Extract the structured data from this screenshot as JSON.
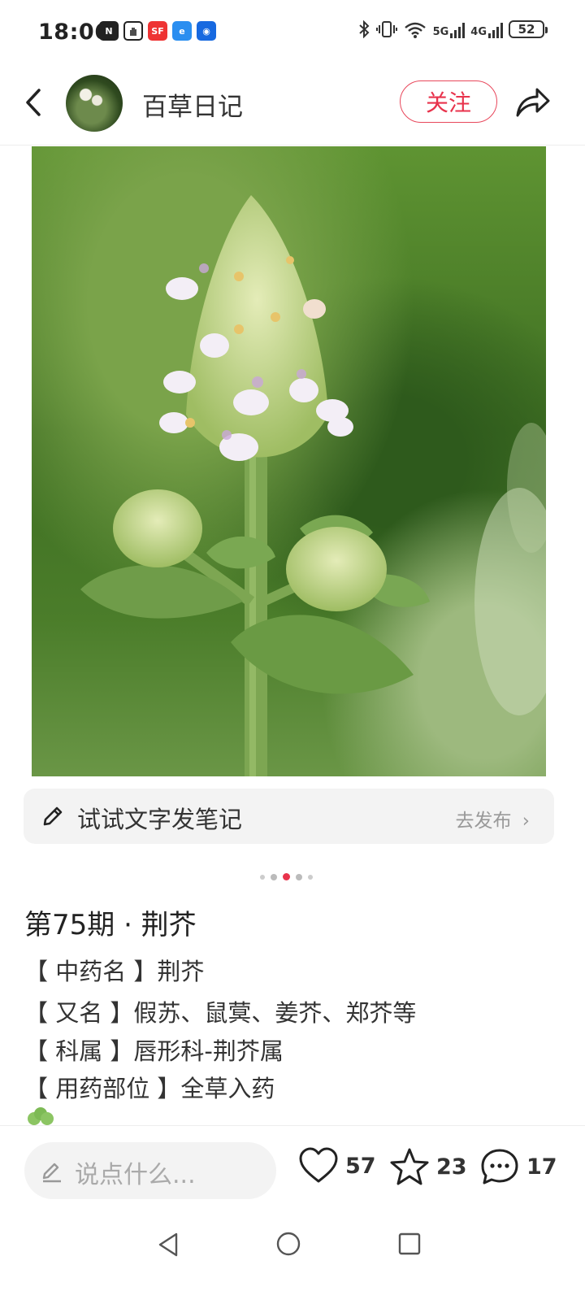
{
  "status_bar": {
    "time": "18:06",
    "network_5g": "5G",
    "network_4g": "4G",
    "battery": "52"
  },
  "header": {
    "author_name": "百草日记",
    "follow_label": "关注"
  },
  "note_prompt": {
    "text": "试试文字发笔记",
    "action": "去发布"
  },
  "carousel": {
    "count": 5,
    "active_index": 2
  },
  "post": {
    "title": "第75期 · 荆芥",
    "lines": [
      "【 中药名 】荆芥",
      "【 又名 】假苏、鼠蓂、姜芥、郑芥等",
      "【 科属 】唇形科-荆芥属",
      "【 用药部位 】全草入药"
    ]
  },
  "bottom_bar": {
    "comment_placeholder": "说点什么...",
    "likes": "57",
    "collects": "23",
    "comments": "17"
  },
  "colors": {
    "accent": "#e8334c"
  }
}
